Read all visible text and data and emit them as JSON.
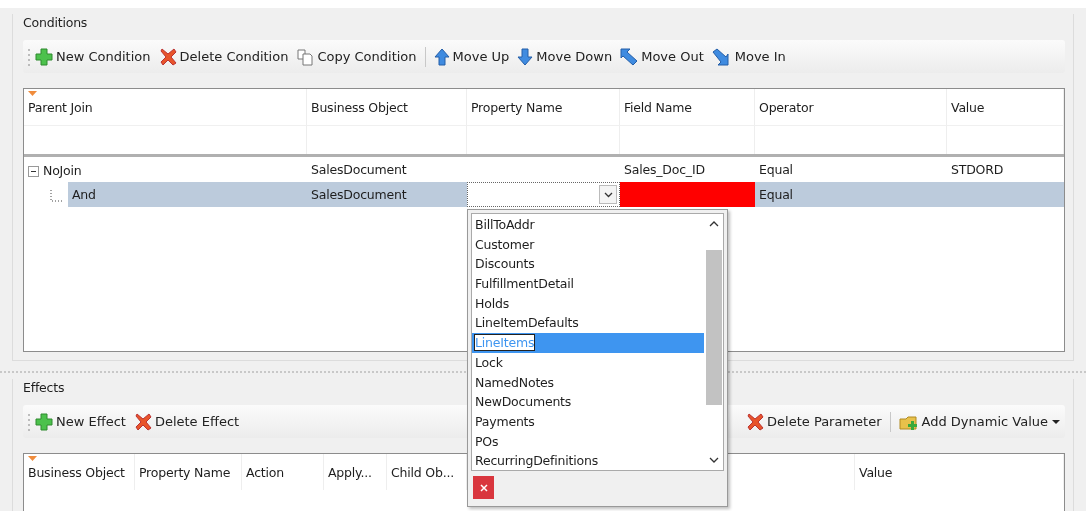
{
  "conditions": {
    "title": "Conditions",
    "toolbar": [
      {
        "kind": "add",
        "label": "New Condition"
      },
      {
        "kind": "delete",
        "label": "Delete Condition"
      },
      {
        "kind": "copy",
        "label": "Copy Condition"
      },
      {
        "kind": "separator"
      },
      {
        "kind": "up",
        "label": "Move Up"
      },
      {
        "kind": "down",
        "label": "Move Down"
      },
      {
        "kind": "out",
        "label": "Move Out"
      },
      {
        "kind": "in",
        "label": "Move In"
      }
    ],
    "columns": [
      "Parent Join",
      "Business Object",
      "Property Name",
      "Field Name",
      "Operator",
      "Value"
    ],
    "rows": [
      {
        "cells": [
          {
            "text": "NoJoin"
          },
          {
            "text": "SalesDocument"
          },
          {},
          {
            "text": "Sales_Doc_ID"
          },
          {
            "text": "Equal"
          },
          {
            "text": "STDORD"
          }
        ],
        "selected": false,
        "expanded": true,
        "children": [
          {
            "cells": [
              {
                "text": "And"
              },
              {
                "text": "SalesDocument"
              },
              {
                "editing": true
              },
              {
                "error": true
              },
              {
                "text": "Equal"
              },
              {}
            ],
            "selected": true
          }
        ]
      }
    ]
  },
  "dropdown": {
    "items": [
      {
        "label": "BillToAddr",
        "selected": false
      },
      {
        "label": "Customer",
        "selected": false
      },
      {
        "label": "Discounts",
        "selected": false
      },
      {
        "label": "FulfillmentDetail",
        "selected": false
      },
      {
        "label": "Holds",
        "selected": false
      },
      {
        "label": "LineItemDefaults",
        "selected": false
      },
      {
        "label": "LineItems",
        "selected": true
      },
      {
        "label": "Lock",
        "selected": false
      },
      {
        "label": "NamedNotes",
        "selected": false
      },
      {
        "label": "NewDocuments",
        "selected": false
      },
      {
        "label": "Payments",
        "selected": false
      },
      {
        "label": "POs",
        "selected": false
      },
      {
        "label": "RecurringDefinitions",
        "selected": false
      }
    ]
  },
  "effects": {
    "title": "Effects",
    "toolbar": [
      {
        "kind": "add",
        "label": "New Effect"
      },
      {
        "kind": "delete",
        "label": "Delete Effect"
      },
      {
        "kind": "gap"
      },
      {
        "kind": "delete",
        "label": "Delete Parameter"
      },
      {
        "kind": "separator"
      },
      {
        "kind": "dynamic",
        "label": "Add Dynamic Value",
        "has_menu": true
      }
    ],
    "columns": [
      "Business Object",
      "Property Name",
      "Action",
      "Apply...",
      "Child Ob...",
      "Value"
    ]
  }
}
